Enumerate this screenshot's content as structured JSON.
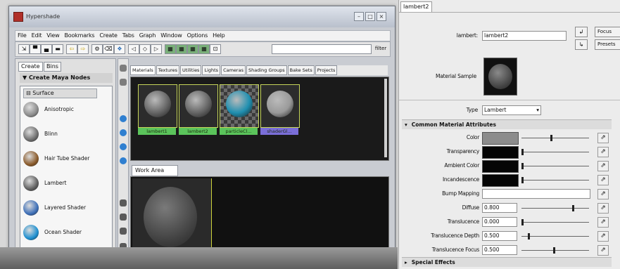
{
  "hypershade": {
    "title": "Hypershade",
    "menu": [
      "File",
      "Edit",
      "View",
      "Bookmarks",
      "Create",
      "Tabs",
      "Graph",
      "Window",
      "Options",
      "Help"
    ],
    "filter_label": "filter",
    "left_tabs": [
      "Create",
      "Bins"
    ],
    "create_header": "Create Maya Nodes",
    "surface_header": "Surface",
    "shaders": [
      {
        "label": "Anisotropic",
        "color": "#8a8a8a"
      },
      {
        "label": "Blinn",
        "color": "#6d6d6d"
      },
      {
        "label": "Hair Tube Shader",
        "color": "#8a5a2a"
      },
      {
        "label": "Lambert",
        "color": "#5f5f5f"
      },
      {
        "label": "Layered Shader",
        "color": "#3d6fb8"
      },
      {
        "label": "Ocean Shader",
        "color": "#1d8fd0"
      }
    ],
    "material_tabs": [
      "Materials",
      "Textures",
      "Utilities",
      "Lights",
      "Cameras",
      "Shading Groups",
      "Bake Sets",
      "Projects"
    ],
    "materials": [
      {
        "name": "lambert1",
        "ball": "#666666",
        "label_bg": "#5bc45b"
      },
      {
        "name": "lambert2",
        "ball": "#666666",
        "label_bg": "#5bc45b"
      },
      {
        "name": "particleCl...",
        "ball": "#1f8fb0",
        "label_bg": "#5bc45b"
      },
      {
        "name": "shaderGl...",
        "ball": "#9a9a9a",
        "label_bg": "#7a6ed8"
      }
    ],
    "work_tab": "Work Area"
  },
  "attribute_editor": {
    "tab": "lambert2",
    "lambert_label": "lambert:",
    "lambert_value": "lambert2",
    "focus_label": "Focus",
    "presets_label": "Presets",
    "material_sample_label": "Material Sample",
    "type_label": "Type",
    "type_value": "Lambert",
    "common_section": "Common Material Attributes",
    "rows": [
      {
        "label": "Color",
        "kind": "color",
        "color": "#8c8c8c",
        "slider": 0.45
      },
      {
        "label": "Transparency",
        "kind": "color",
        "color": "#050505",
        "slider": 0.0
      },
      {
        "label": "Ambient Color",
        "kind": "color",
        "color": "#050505",
        "slider": 0.0
      },
      {
        "label": "Incandescence",
        "kind": "color",
        "color": "#050505",
        "slider": 0.0
      },
      {
        "label": "Bump Mapping",
        "kind": "field",
        "value": ""
      },
      {
        "label": "Diffuse",
        "kind": "num",
        "value": "0.800",
        "slider": 0.8
      },
      {
        "label": "Translucence",
        "kind": "num",
        "value": "0.000",
        "slider": 0.0
      },
      {
        "label": "Translucence Depth",
        "kind": "num",
        "value": "0.500",
        "slider": 0.1
      },
      {
        "label": "Translucence Focus",
        "kind": "num",
        "value": "0.500",
        "slider": 0.5
      }
    ],
    "special_section": "Special Effects"
  },
  "colors": {
    "accent_green": "#c7d65a",
    "dark": "#1a1a1a"
  }
}
